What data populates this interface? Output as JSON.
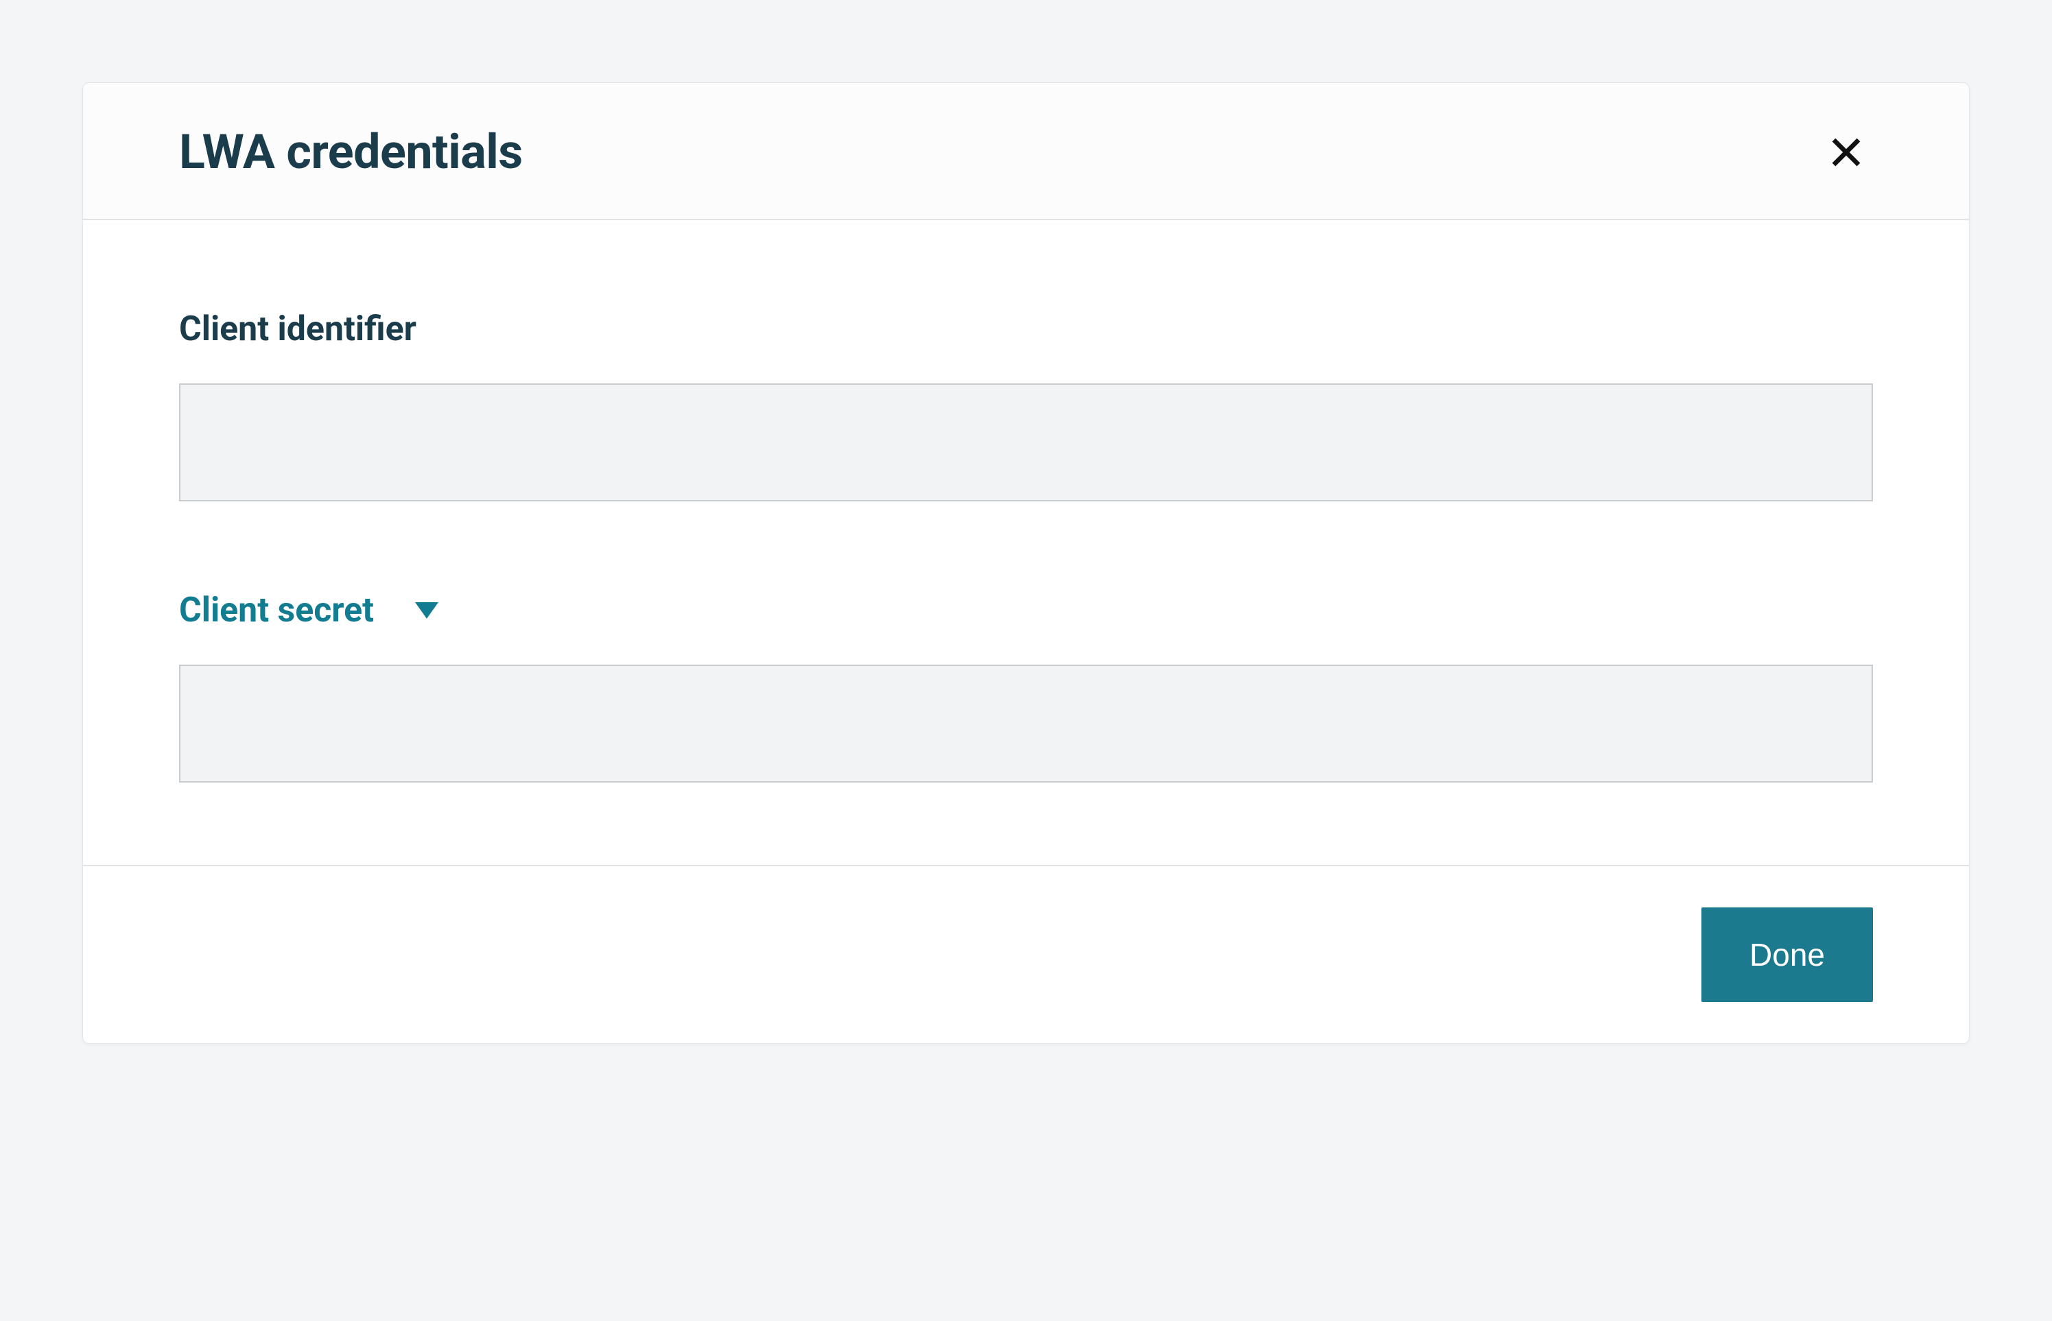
{
  "modal": {
    "title": "LWA credentials",
    "fields": {
      "client_identifier": {
        "label": "Client identifier",
        "value": ""
      },
      "client_secret": {
        "label": "Client secret",
        "value": ""
      }
    },
    "buttons": {
      "done": "Done"
    }
  }
}
